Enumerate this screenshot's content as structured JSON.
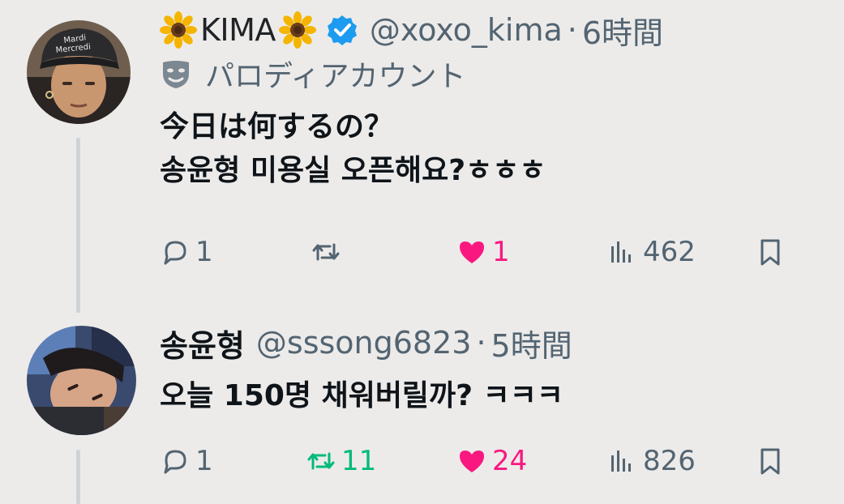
{
  "tweets": [
    {
      "display_name": "KIMA",
      "handle": "@xoxo_kima",
      "separator": "·",
      "time": "6時間",
      "parody_label": "パロディアカウント",
      "text_line1": "今日は何するの？",
      "text_line2": "송윤형 미용실 오픈해요?ㅎㅎㅎ",
      "replies": "1",
      "retweets": "",
      "likes": "1",
      "views": "462",
      "liked": true,
      "retweeted": false,
      "icons": [
        "sunflower-emoji",
        "verified-badge-icon",
        "parody-mask-icon",
        "reply-icon",
        "retweet-icon",
        "heart-filled-icon",
        "views-icon",
        "bookmark-icon"
      ]
    },
    {
      "display_name": "송윤형",
      "handle": "@sssong6823",
      "separator": "·",
      "time": "5時間",
      "text_line1": "오늘 150명 채워버릴까? ㅋㅋㅋ",
      "replies": "1",
      "retweets": "11",
      "likes": "24",
      "views": "826",
      "liked": true,
      "retweeted": true,
      "icons": [
        "reply-icon",
        "retweet-icon",
        "heart-filled-icon",
        "views-icon",
        "bookmark-icon"
      ]
    }
  ],
  "colors": {
    "background": "#ecebea",
    "text": "#0f1419",
    "secondary": "#536471",
    "verified": "#1d9bf0",
    "like": "#f91880",
    "retweet": "#00ba7c",
    "thread_line": "#cfd3d6"
  }
}
